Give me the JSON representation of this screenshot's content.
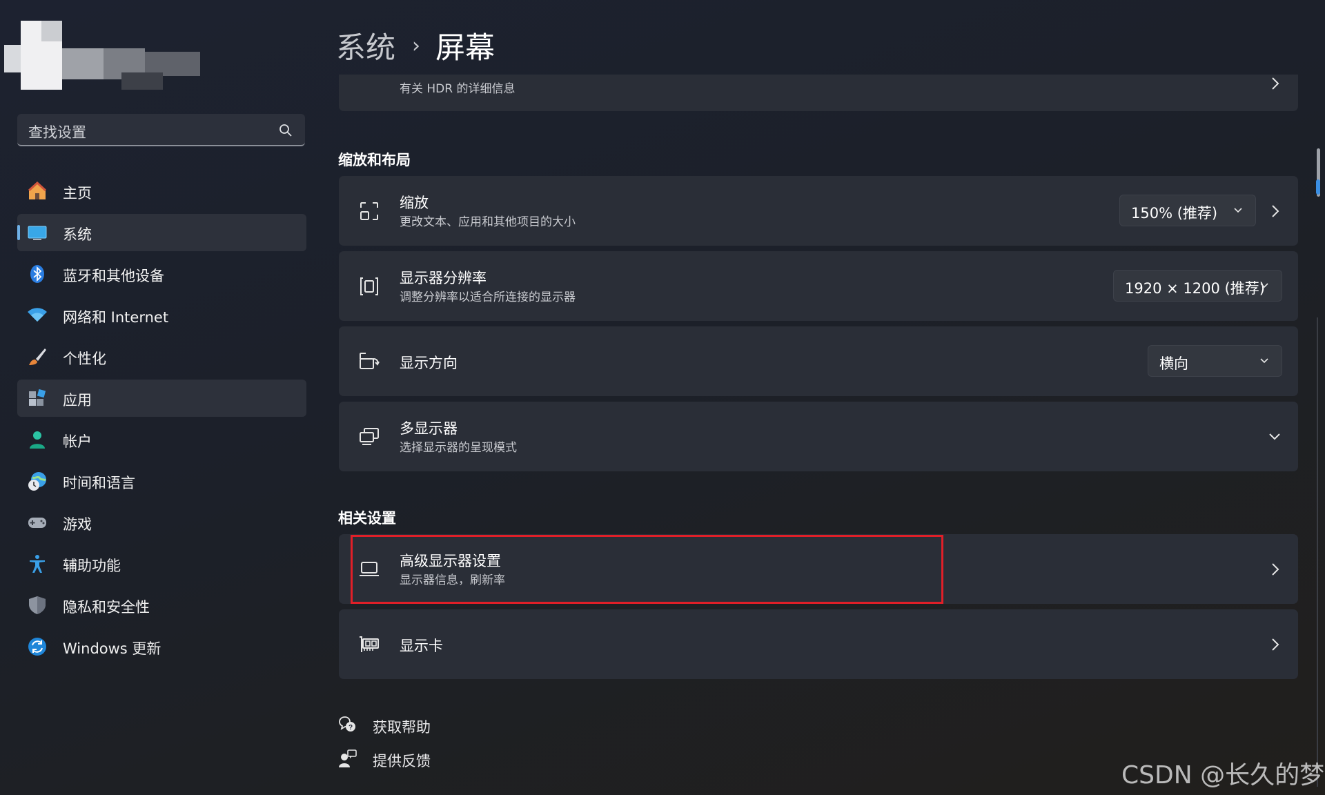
{
  "sidebar": {
    "search_placeholder": "查找设置",
    "items": [
      {
        "label": "主页",
        "icon": "home-icon"
      },
      {
        "label": "系统",
        "icon": "monitor-icon"
      },
      {
        "label": "蓝牙和其他设备",
        "icon": "bluetooth-icon"
      },
      {
        "label": "网络和 Internet",
        "icon": "wifi-icon"
      },
      {
        "label": "个性化",
        "icon": "brush-icon"
      },
      {
        "label": "应用",
        "icon": "apps-icon"
      },
      {
        "label": "帐户",
        "icon": "account-icon"
      },
      {
        "label": "时间和语言",
        "icon": "globe-clock-icon"
      },
      {
        "label": "游戏",
        "icon": "gamepad-icon"
      },
      {
        "label": "辅助功能",
        "icon": "accessibility-icon"
      },
      {
        "label": "隐私和安全性",
        "icon": "shield-icon"
      },
      {
        "label": "Windows 更新",
        "icon": "update-icon"
      }
    ],
    "selected": "系统"
  },
  "header": {
    "parent": "系统",
    "separator": "›",
    "current": "屏幕"
  },
  "main": {
    "hdr_card": {
      "subtitle": "有关 HDR 的详细信息",
      "icon": "hdr-icon"
    },
    "section_scale": "缩放和布局",
    "scale": {
      "title": "缩放",
      "subtitle": "更改文本、应用和其他项目的大小",
      "value": "150% (推荐)",
      "icon": "scale-icon"
    },
    "resolution": {
      "title": "显示器分辨率",
      "subtitle": "调整分辨率以适合所连接的显示器",
      "value": "1920 × 1200 (推荐)",
      "icon": "resolution-icon"
    },
    "orientation": {
      "title": "显示方向",
      "value": "横向",
      "icon": "rotate-icon"
    },
    "multi": {
      "title": "多显示器",
      "subtitle": "选择显示器的呈现模式",
      "icon": "multi-display-icon"
    },
    "section_related": "相关设置",
    "advanced": {
      "title": "高级显示器设置",
      "subtitle": "显示器信息，刷新率",
      "icon": "laptop-icon"
    },
    "gpu": {
      "title": "显示卡",
      "icon": "gpu-icon"
    },
    "help": "获取帮助",
    "feedback": "提供反馈"
  },
  "colors": {
    "highlight": "#e01f28",
    "accent": "#6fb0e6",
    "card": "#2a2e37"
  },
  "watermark": "CSDN @长久的梦"
}
